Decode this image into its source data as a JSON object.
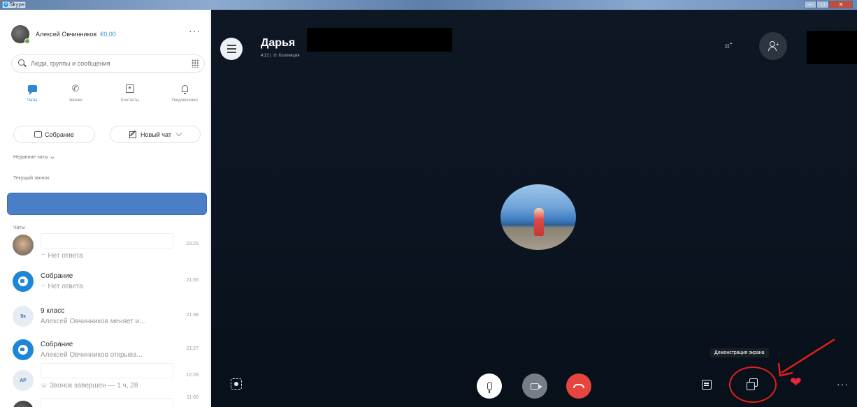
{
  "window": {
    "title": "Skype"
  },
  "profile": {
    "name": "Алексей Овчинников",
    "credit": "€0,00",
    "more": "···"
  },
  "search": {
    "placeholder": "Люди, группы и сообщения"
  },
  "nav": {
    "items": [
      {
        "label": "Чаты",
        "icon": "chat-icon",
        "active": true
      },
      {
        "label": "Звонки",
        "icon": "phone-icon",
        "active": false
      },
      {
        "label": "Контакты",
        "icon": "contacts-icon",
        "active": false
      },
      {
        "label": "Уведомления",
        "icon": "bell-icon",
        "active": false
      }
    ]
  },
  "actions": {
    "meeting_label": "Собрание",
    "new_chat_label": "Новый чат"
  },
  "sections": {
    "recent_chats": "Недавние чаты",
    "current_call": "Текущий звонок",
    "chats": "Чаты"
  },
  "chats": [
    {
      "name": "",
      "preview": "Нет ответа",
      "time": "23:23",
      "avatar": "photo",
      "redacted": true
    },
    {
      "name": "Собрание",
      "preview": "Нет ответа",
      "time": "21:55",
      "avatar": "meeting",
      "redacted": false
    },
    {
      "name": "9 класс",
      "preview": "Алексей Овчинников меняет и...",
      "time": "21:39",
      "avatar": "initials",
      "initials": "9к",
      "redacted": false
    },
    {
      "name": "Собрание",
      "preview": "Алексей Овчинников открыва...",
      "time": "21:27",
      "avatar": "meeting",
      "redacted": false
    },
    {
      "name": "",
      "preview": "Звонок завершен — 1 ч, 28",
      "time": "12:28",
      "avatar": "initials",
      "initials": "AP",
      "redacted": true
    },
    {
      "name": "",
      "preview": "",
      "time": "11:00",
      "avatar": "dark",
      "redacted": true
    }
  ],
  "call": {
    "contact_name": "Дарья",
    "meta": "4:22 | ☏ Коллекция",
    "tooltip": "Демонстрация экрана"
  },
  "colors": {
    "accent": "#2f86d4",
    "call_background": "#0b1420",
    "hangup": "#e6453d",
    "annotation": "#e0201b",
    "heart": "#e4263f"
  }
}
